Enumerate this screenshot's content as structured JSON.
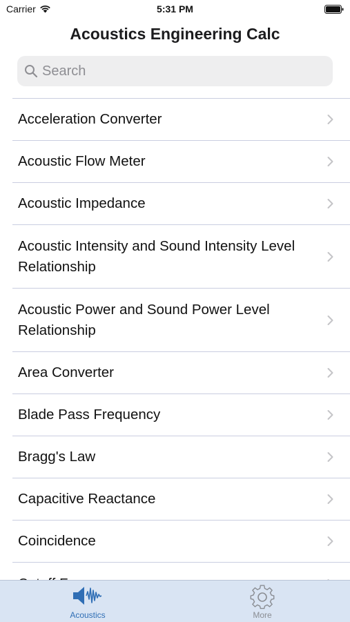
{
  "status_bar": {
    "carrier": "Carrier",
    "time": "5:31 PM"
  },
  "nav": {
    "title": "Acoustics Engineering Calc"
  },
  "search": {
    "placeholder": "Search",
    "value": ""
  },
  "list": {
    "items": [
      {
        "label": "Acceleration Converter"
      },
      {
        "label": "Acoustic Flow Meter"
      },
      {
        "label": "Acoustic Impedance"
      },
      {
        "label": "Acoustic Intensity and Sound Intensity Level Relationship"
      },
      {
        "label": "Acoustic Power and Sound Power Level Relationship"
      },
      {
        "label": "Area Converter"
      },
      {
        "label": "Blade Pass Frequency"
      },
      {
        "label": "Bragg's Law"
      },
      {
        "label": "Capacitive Reactance"
      },
      {
        "label": "Coincidence"
      },
      {
        "label": "Cutoff F..."
      }
    ]
  },
  "tabs": [
    {
      "label": "Acoustics",
      "icon": "speaker-soundwave-icon",
      "selected": true
    },
    {
      "label": "More",
      "icon": "gear-icon",
      "selected": false
    }
  ],
  "colors": {
    "accent": "#2f6eb5",
    "tab_bar_bg": "#d9e4f3",
    "separator": "#c9cde0"
  }
}
